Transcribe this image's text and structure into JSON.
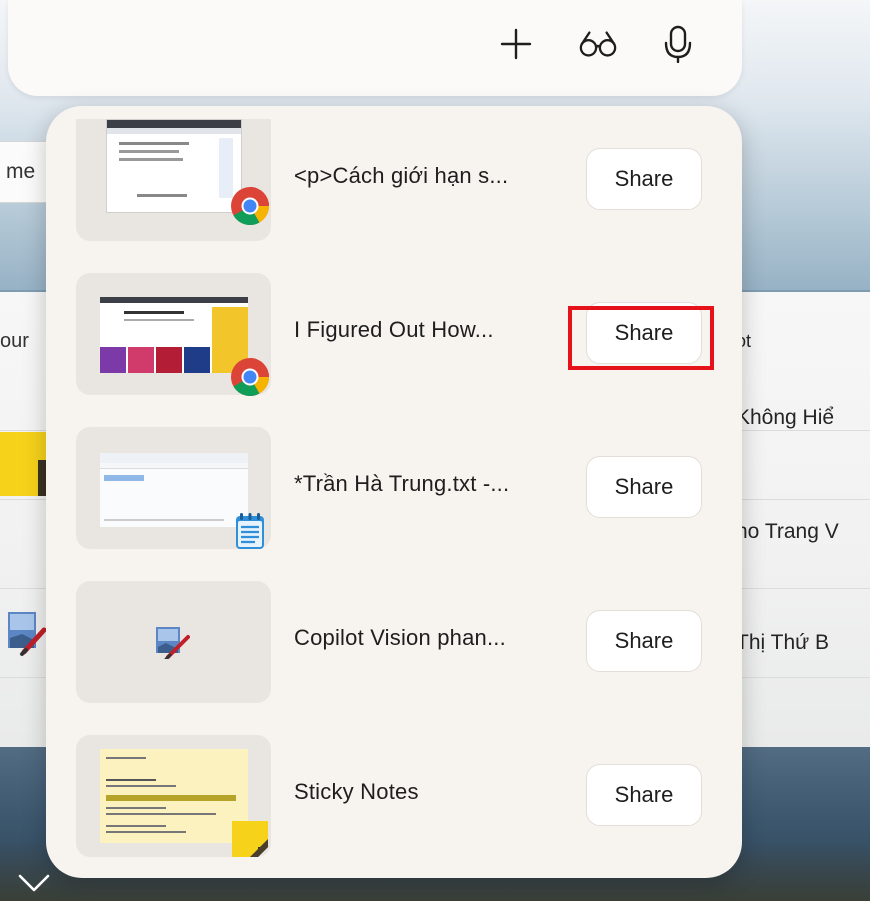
{
  "colors": {
    "accent_highlight": "#e5121a",
    "popup_bg": "#f7f3ef",
    "thumb_bg": "#e9e5e1",
    "share_bg": "#ffffff"
  },
  "top_bar": {
    "icons": [
      "plus-icon",
      "glasses-icon",
      "microphone-icon"
    ]
  },
  "background": {
    "search_fragment": "me",
    "left_label": "our",
    "right_labels": [
      "ot",
      "Không Hiể",
      "ho Trang V",
      "Thị Thứ B"
    ]
  },
  "windows": [
    {
      "title": "<p>Cách giới hạn s...",
      "app": "chrome",
      "share_label": "Share"
    },
    {
      "title": "I Figured Out How...",
      "app": "chrome",
      "share_label": "Share"
    },
    {
      "title": "*Trần Hà Trung.txt -...",
      "app": "notepad",
      "share_label": "Share"
    },
    {
      "title": "Copilot Vision phan...",
      "app": "paint",
      "share_label": "Share"
    },
    {
      "title": "Sticky Notes",
      "app": "sticky-notes",
      "share_label": "Share"
    }
  ],
  "bottom": {
    "icon": "chevron-down-icon"
  }
}
